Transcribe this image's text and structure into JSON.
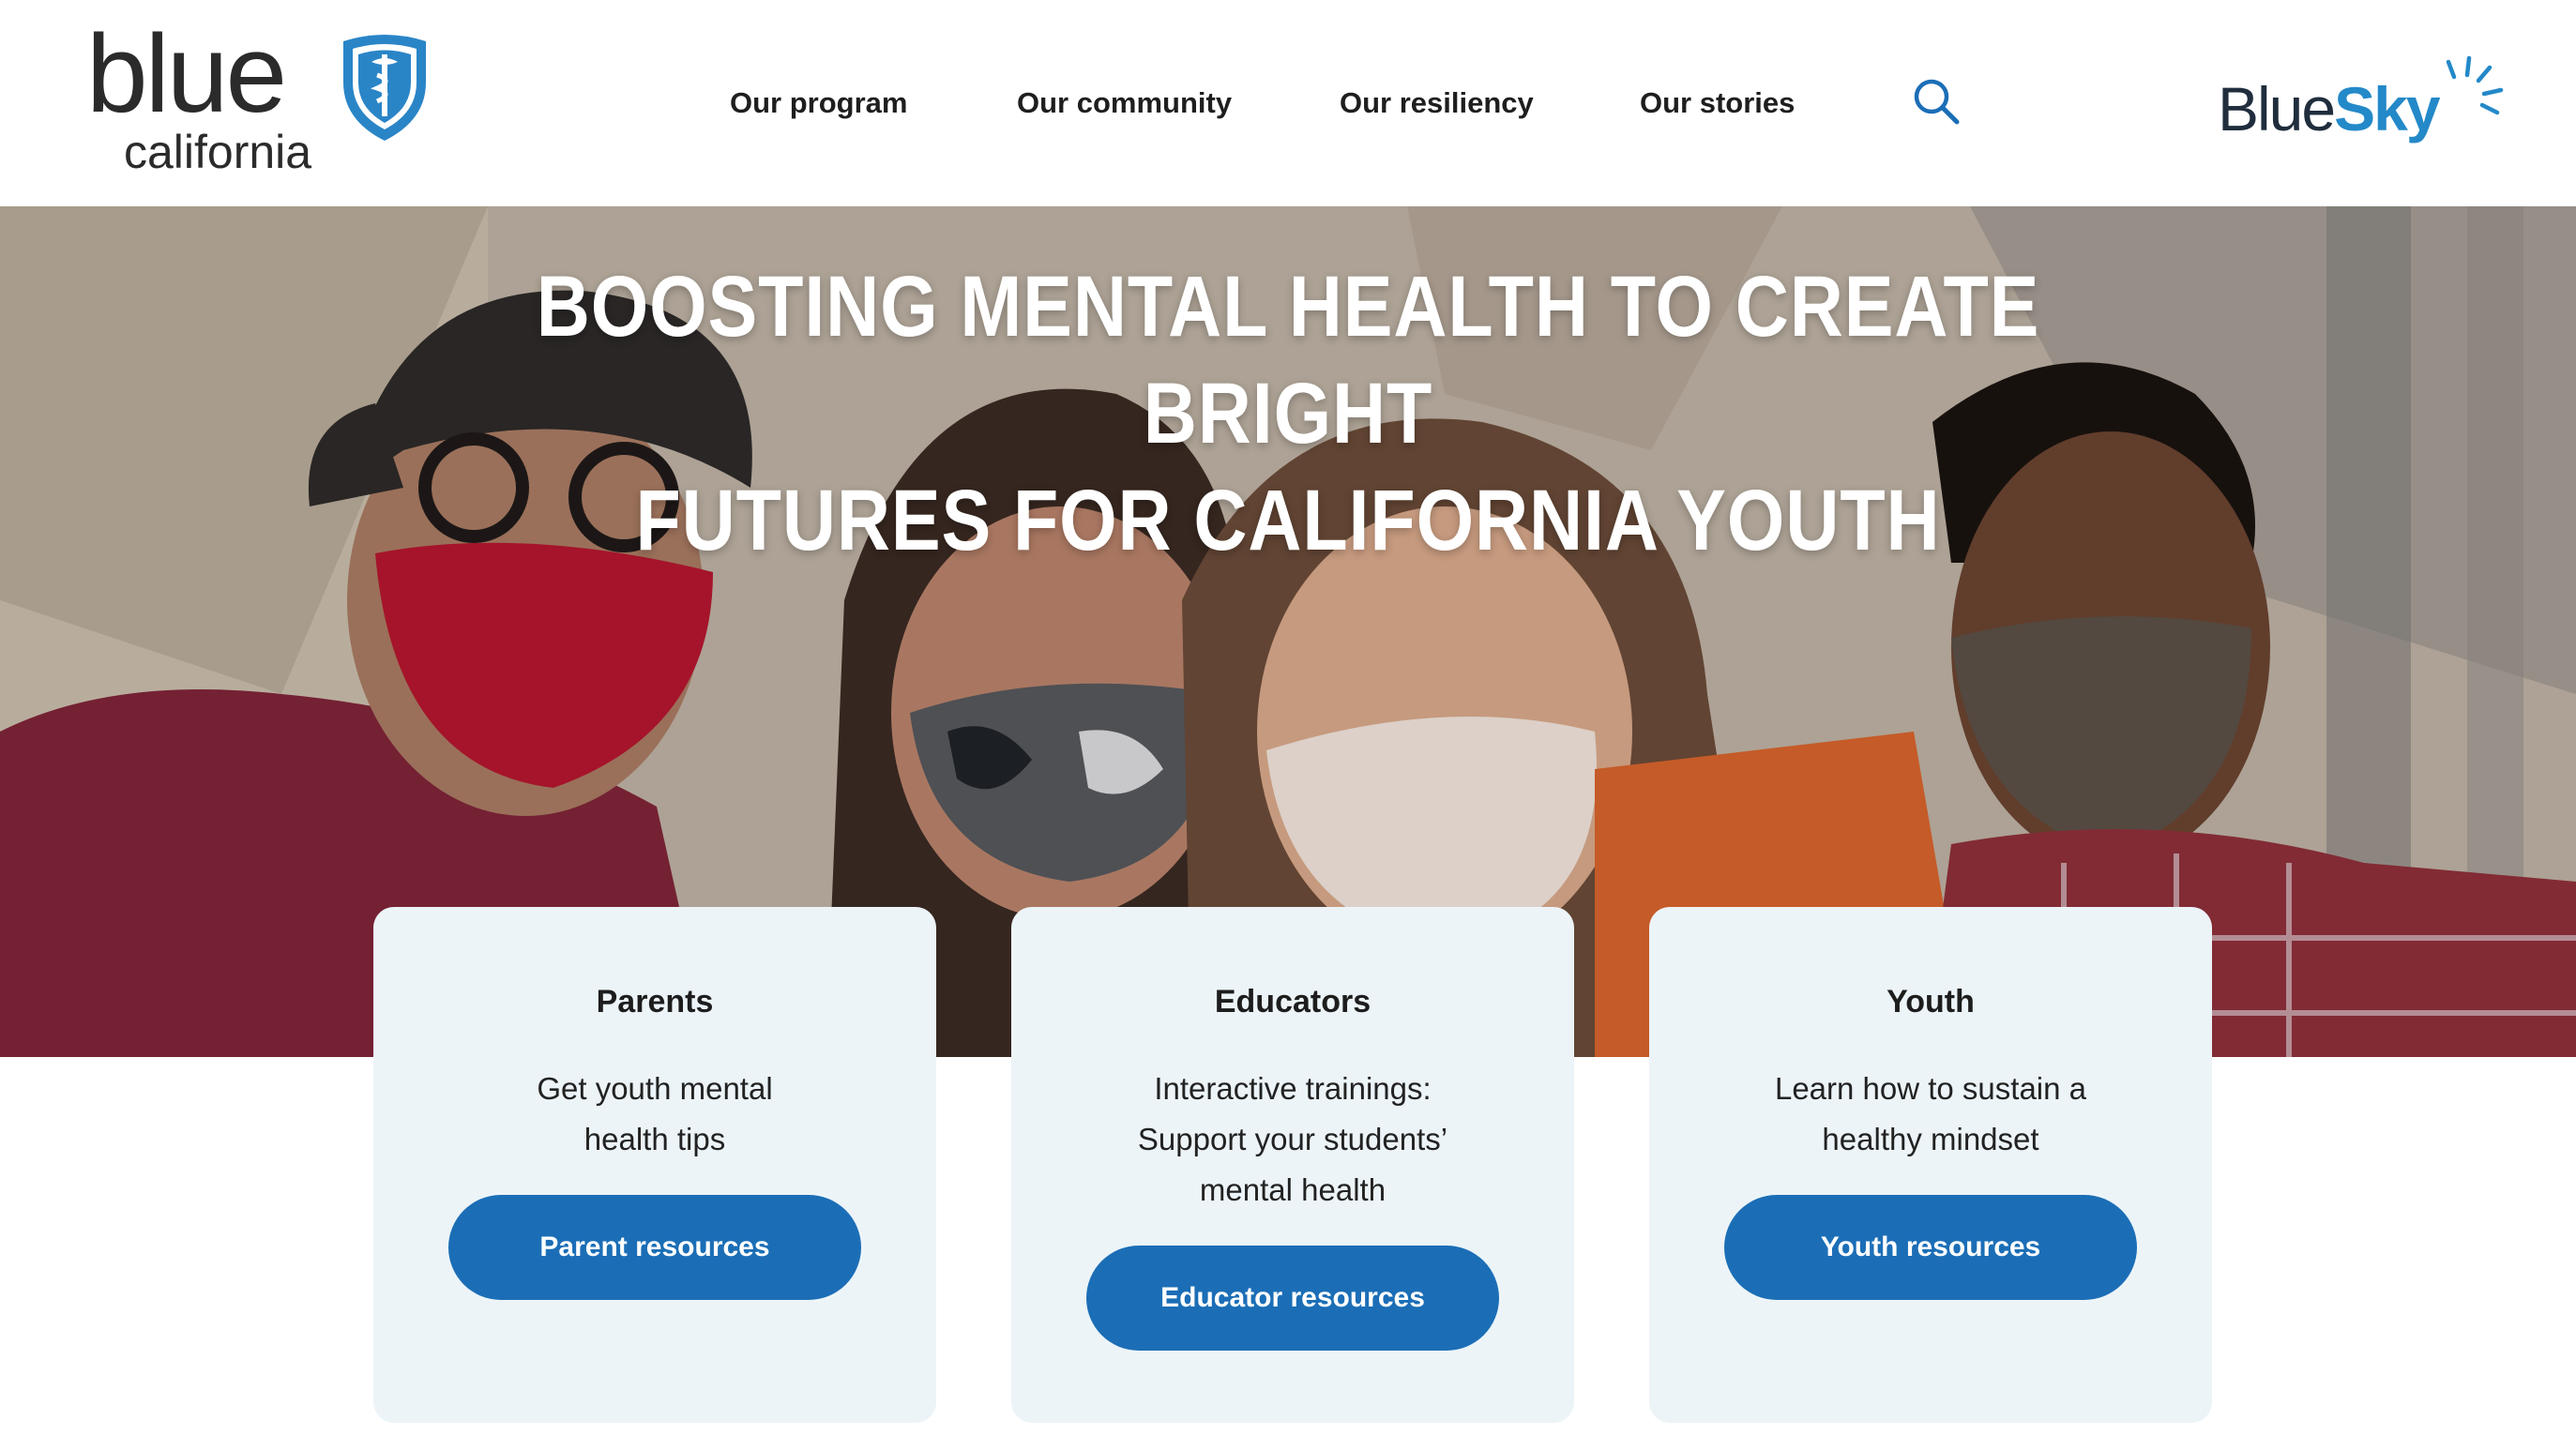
{
  "brand": {
    "logo_word": "blue",
    "logo_sub": "california",
    "partner_word_1": "Blue",
    "partner_word_2": "Sky"
  },
  "nav": {
    "items": [
      {
        "label": "Our program"
      },
      {
        "label": "Our community"
      },
      {
        "label": "Our resiliency"
      },
      {
        "label": "Our stories"
      }
    ],
    "search_icon": "search-icon"
  },
  "hero": {
    "title_line1": "BOOSTING MENTAL HEALTH TO CREATE BRIGHT",
    "title_line2": "FUTURES FOR CALIFORNIA YOUTH"
  },
  "cards": [
    {
      "title": "Parents",
      "desc_lines": [
        "Get youth mental",
        "health tips"
      ],
      "button": "Parent resources"
    },
    {
      "title": "Educators",
      "desc_lines": [
        "Interactive trainings:",
        "Support your students’",
        "mental health"
      ],
      "button": "Educator resources"
    },
    {
      "title": "Youth",
      "desc_lines": [
        "Learn how to sustain a",
        "healthy mindset"
      ],
      "button": "Youth resources"
    }
  ],
  "colors": {
    "primary_button": "#1b6eb6",
    "card_background": "#ecf4f8",
    "brand_blue": "#2489c8"
  }
}
